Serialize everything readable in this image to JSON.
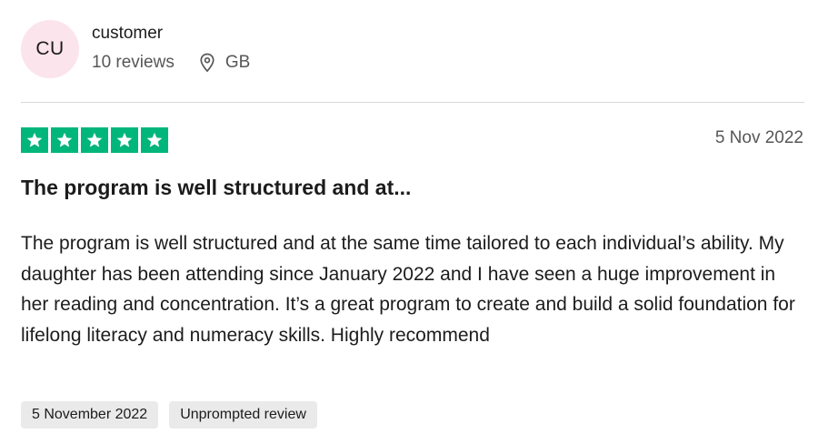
{
  "reviewer": {
    "initials": "CU",
    "name": "customer",
    "reviews_count": "10 reviews",
    "country": "GB",
    "avatar_color": "#fce4ec"
  },
  "review": {
    "rating": 5,
    "max_rating": 5,
    "star_color": "#00b67a",
    "date": "5 Nov 2022",
    "title": "The program is well structured and at...",
    "body": "The program is well structured and at the same time tailored to each individual’s ability. My daughter has been attending since January 2022 and I have seen a huge improvement in her reading and concentration. It’s a great program to create and build a solid foundation for lifelong literacy and numeracy skills. Highly recommend",
    "tags": [
      "5 November 2022",
      "Unprompted review"
    ]
  },
  "icons": {
    "location": "location-pin-icon",
    "star": "star-icon"
  }
}
